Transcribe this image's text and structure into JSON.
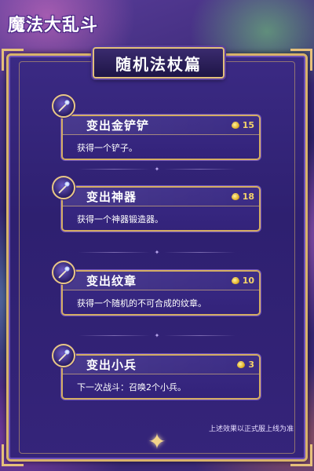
{
  "game": {
    "logo": "魔法大乱斗"
  },
  "panel": {
    "title": "随机法杖篇"
  },
  "items": [
    {
      "name": "变出金铲铲",
      "cost": "15",
      "desc": "获得一个铲子。",
      "icon": "magic-wand-icon"
    },
    {
      "name": "变出神器",
      "cost": "18",
      "desc": "获得一个神器锻造器。",
      "icon": "magic-wand-icon"
    },
    {
      "name": "变出纹章",
      "cost": "10",
      "desc": "获得一个随机的不可合成的纹章。",
      "icon": "magic-wand-icon"
    },
    {
      "name": "变出小兵",
      "cost": "3",
      "desc": "下一次战斗：召唤2个小兵。",
      "icon": "magic-wand-icon"
    }
  ],
  "footnote": "上述效果以正式服上线为准",
  "colors": {
    "gold": "#d9b36a",
    "panel": "#2e2070",
    "coin": "#f4d46a"
  }
}
